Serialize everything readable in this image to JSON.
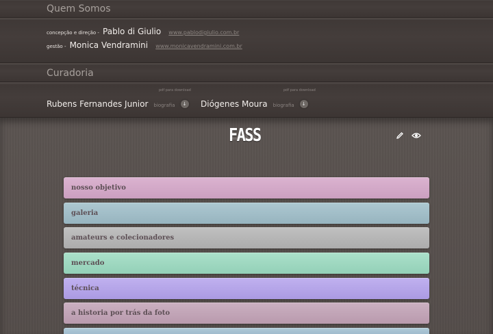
{
  "quem_somos": {
    "heading": "Quem Somos",
    "credits": [
      {
        "role": "concepção e direção -",
        "name": "Pablo di Giulio",
        "url": "www.pablodigiulio.com.br"
      },
      {
        "role": "gestão -",
        "name": "Monica Vendramini",
        "url": "www.monicavendramini.com.br"
      }
    ]
  },
  "curadoria": {
    "heading": "Curadoria",
    "pdf_note": "pdf para download",
    "bio_label": "biografia",
    "curators": [
      {
        "name": "Rubens Fernandes Junior"
      },
      {
        "name": "Diógenes Moura"
      }
    ]
  },
  "header": {
    "logo": "FASS",
    "icons": [
      "pencil-icon",
      "eye-icon"
    ]
  },
  "menu": {
    "items": [
      {
        "label": "nosso objetivo",
        "color": "#d3a8c8"
      },
      {
        "label": "galeria",
        "color": "#a2bec8"
      },
      {
        "label": "amateurs e colecionadores",
        "color": "#b6b6b6"
      },
      {
        "label": "mercado",
        "color": "#9fd8c1"
      },
      {
        "label": "técnica",
        "color": "#b6a6ea"
      },
      {
        "label": "a historia por trás da foto",
        "color": "#c3a5b8"
      },
      {
        "label": "",
        "color": "#a6c0d0"
      }
    ]
  }
}
